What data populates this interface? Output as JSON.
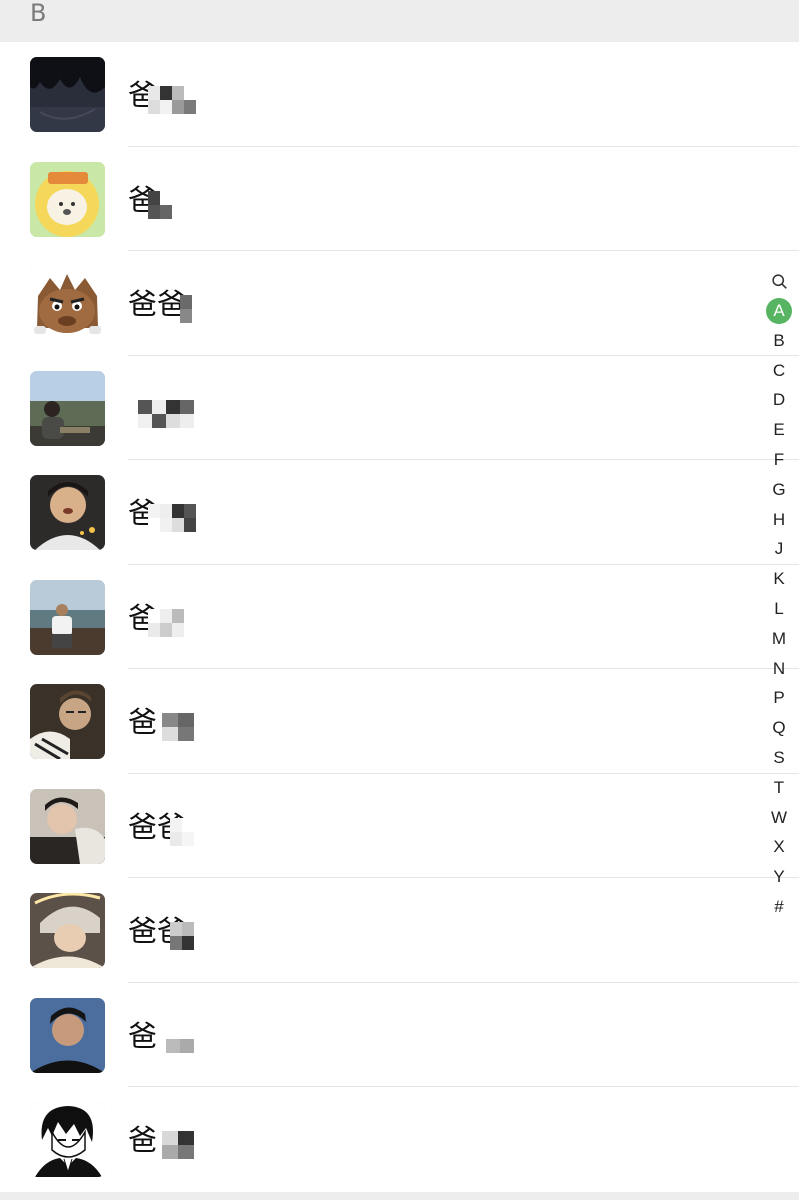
{
  "section": {
    "letter": "B"
  },
  "contacts": [
    {
      "name": "爸",
      "avatar": "dark-anime-hair-avatar"
    },
    {
      "name": "爸",
      "avatar": "cartoon-sheep-costume-avatar"
    },
    {
      "name": "爸爸",
      "avatar": "cartoon-wolf-avatar"
    },
    {
      "name": "",
      "avatar": "man-outdoor-photo-avatar"
    },
    {
      "name": "爸",
      "avatar": "young-man-selfie-avatar"
    },
    {
      "name": "爸",
      "avatar": "man-on-boat-avatar"
    },
    {
      "name": "爸",
      "avatar": "man-glasses-striped-avatar"
    },
    {
      "name": "爸爸",
      "avatar": "man-lying-avatar"
    },
    {
      "name": "爸爸",
      "avatar": "man-cap-avatar"
    },
    {
      "name": "爸",
      "avatar": "young-man-blue-avatar"
    },
    {
      "name": "爸",
      "avatar": "manga-boy-avatar"
    }
  ],
  "index_bar": {
    "search_icon": "search-icon",
    "active": "A",
    "letters": [
      "A",
      "B",
      "C",
      "D",
      "E",
      "F",
      "G",
      "H",
      "J",
      "K",
      "L",
      "M",
      "N",
      "P",
      "Q",
      "S",
      "T",
      "W",
      "X",
      "Y",
      "#"
    ]
  },
  "colors": {
    "accent": "#57b462",
    "header_bg": "#ededed",
    "divider": "#e6e6e6"
  }
}
